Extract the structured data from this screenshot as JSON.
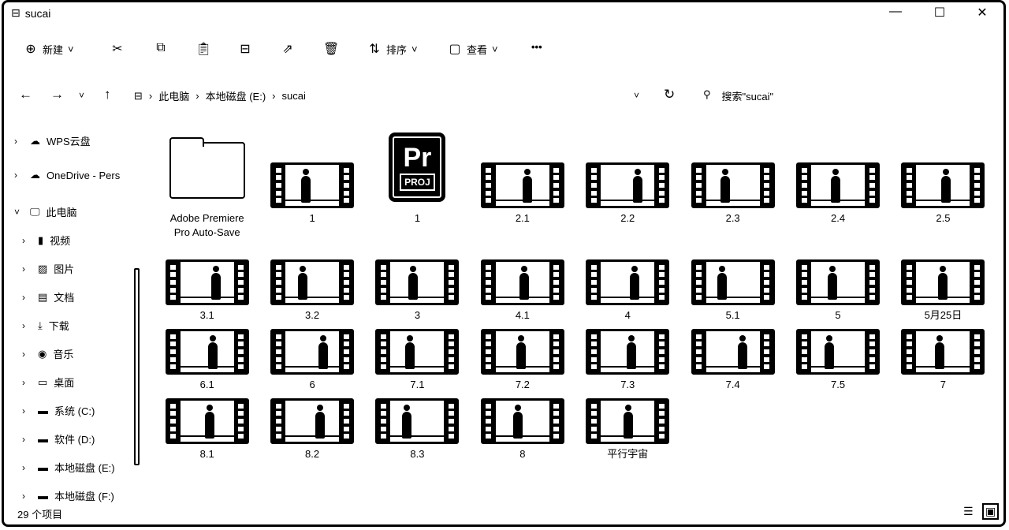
{
  "window": {
    "title": "sucai",
    "minimize": "—",
    "maximize": "☐",
    "close": "✕"
  },
  "toolbar": {
    "new_label": "新建",
    "sort_label": "排序",
    "view_label": "查看",
    "more": "•••"
  },
  "address": {
    "crumbs": [
      "此电脑",
      "本地磁盘 (E:)",
      "sucai"
    ],
    "search_placeholder": "搜索\"sucai\""
  },
  "sidebar": [
    {
      "label": "WPS云盘",
      "icon": "☁",
      "level": 0,
      "expanded": false
    },
    {
      "label": "OneDrive - Pers",
      "icon": "☁",
      "level": 0,
      "expanded": false
    },
    {
      "label": "此电脑",
      "icon": "🖵",
      "level": 0,
      "expanded": true
    },
    {
      "label": "视频",
      "icon": "▮",
      "level": 1
    },
    {
      "label": "图片",
      "icon": "▨",
      "level": 1
    },
    {
      "label": "文档",
      "icon": "▤",
      "level": 1
    },
    {
      "label": "下载",
      "icon": "⤓",
      "level": 1
    },
    {
      "label": "音乐",
      "icon": "◉",
      "level": 1
    },
    {
      "label": "桌面",
      "icon": "▭",
      "level": 1
    },
    {
      "label": "系统 (C:)",
      "icon": "▬",
      "level": 1
    },
    {
      "label": "软件 (D:)",
      "icon": "▬",
      "level": 1
    },
    {
      "label": "本地磁盘 (E:)",
      "icon": "▬",
      "level": 1
    },
    {
      "label": "本地磁盘 (F:)",
      "icon": "▬",
      "level": 1
    }
  ],
  "files": [
    {
      "name": "Adobe Premiere Pro Auto-Save",
      "type": "folder"
    },
    {
      "name": "1",
      "type": "video"
    },
    {
      "name": "1",
      "type": "prproj",
      "icon_text": "Pr",
      "badge": "PROJ"
    },
    {
      "name": "2.1",
      "type": "video"
    },
    {
      "name": "2.2",
      "type": "video"
    },
    {
      "name": "2.3",
      "type": "video"
    },
    {
      "name": "2.4",
      "type": "video"
    },
    {
      "name": "2.5",
      "type": "video"
    },
    {
      "name": "3.1",
      "type": "video"
    },
    {
      "name": "3.2",
      "type": "video"
    },
    {
      "name": "3",
      "type": "video"
    },
    {
      "name": "4.1",
      "type": "video"
    },
    {
      "name": "4",
      "type": "video"
    },
    {
      "name": "5.1",
      "type": "video"
    },
    {
      "name": "5",
      "type": "video"
    },
    {
      "name": "5月25日",
      "type": "video"
    },
    {
      "name": "6.1",
      "type": "video"
    },
    {
      "name": "6",
      "type": "video"
    },
    {
      "name": "7.1",
      "type": "video"
    },
    {
      "name": "7.2",
      "type": "video"
    },
    {
      "name": "7.3",
      "type": "video"
    },
    {
      "name": "7.4",
      "type": "video"
    },
    {
      "name": "7.5",
      "type": "video"
    },
    {
      "name": "7",
      "type": "video"
    },
    {
      "name": "8.1",
      "type": "video"
    },
    {
      "name": "8.2",
      "type": "video"
    },
    {
      "name": "8.3",
      "type": "video"
    },
    {
      "name": "8",
      "type": "video"
    },
    {
      "name": "平行宇宙",
      "type": "video"
    }
  ],
  "status": {
    "item_count": "29 个项目"
  }
}
